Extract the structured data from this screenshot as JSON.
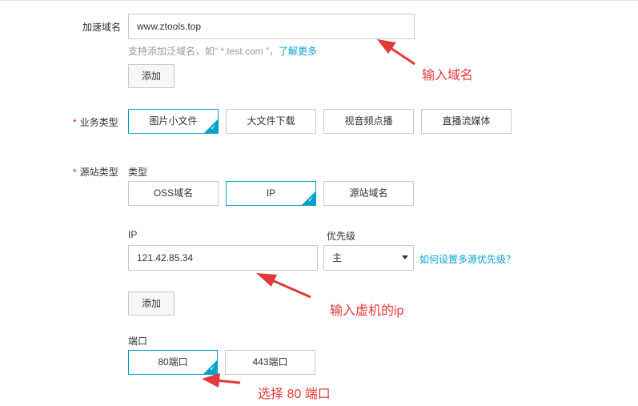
{
  "domain_section": {
    "label": "加速域名",
    "value": "www.ztools.top",
    "hint_prefix": "支持添加泛域名，如“ *.test.com ”，",
    "hint_link": "了解更多",
    "add_label": "添加"
  },
  "business_type": {
    "required_mark": "*",
    "label": "业务类型",
    "options": [
      "图片小文件",
      "大文件下载",
      "视音频点播",
      "直播流媒体"
    ],
    "selected": "图片小文件"
  },
  "origin_type": {
    "required_mark": "*",
    "label": "源站类型",
    "sub_label": "类型",
    "options": [
      "OSS域名",
      "IP",
      "源站域名"
    ],
    "selected": "IP"
  },
  "ip_section": {
    "label": "IP",
    "value": "121.42.85.34",
    "priority_label": "优先级",
    "priority_value": "主",
    "priority_help": "如何设置多源优先级？",
    "add_label": "添加"
  },
  "port_section": {
    "label": "端口",
    "options": [
      "80端口",
      "443端口"
    ],
    "selected": "80端口"
  },
  "annotations": {
    "domain": "输入域名",
    "ip": "输入虚机的ip",
    "port": "选择 80 端口"
  },
  "colors": {
    "accent": "#00a2ca",
    "annotation": "#e03a3a",
    "required": "#e02828",
    "link": "#0aa1d6"
  }
}
